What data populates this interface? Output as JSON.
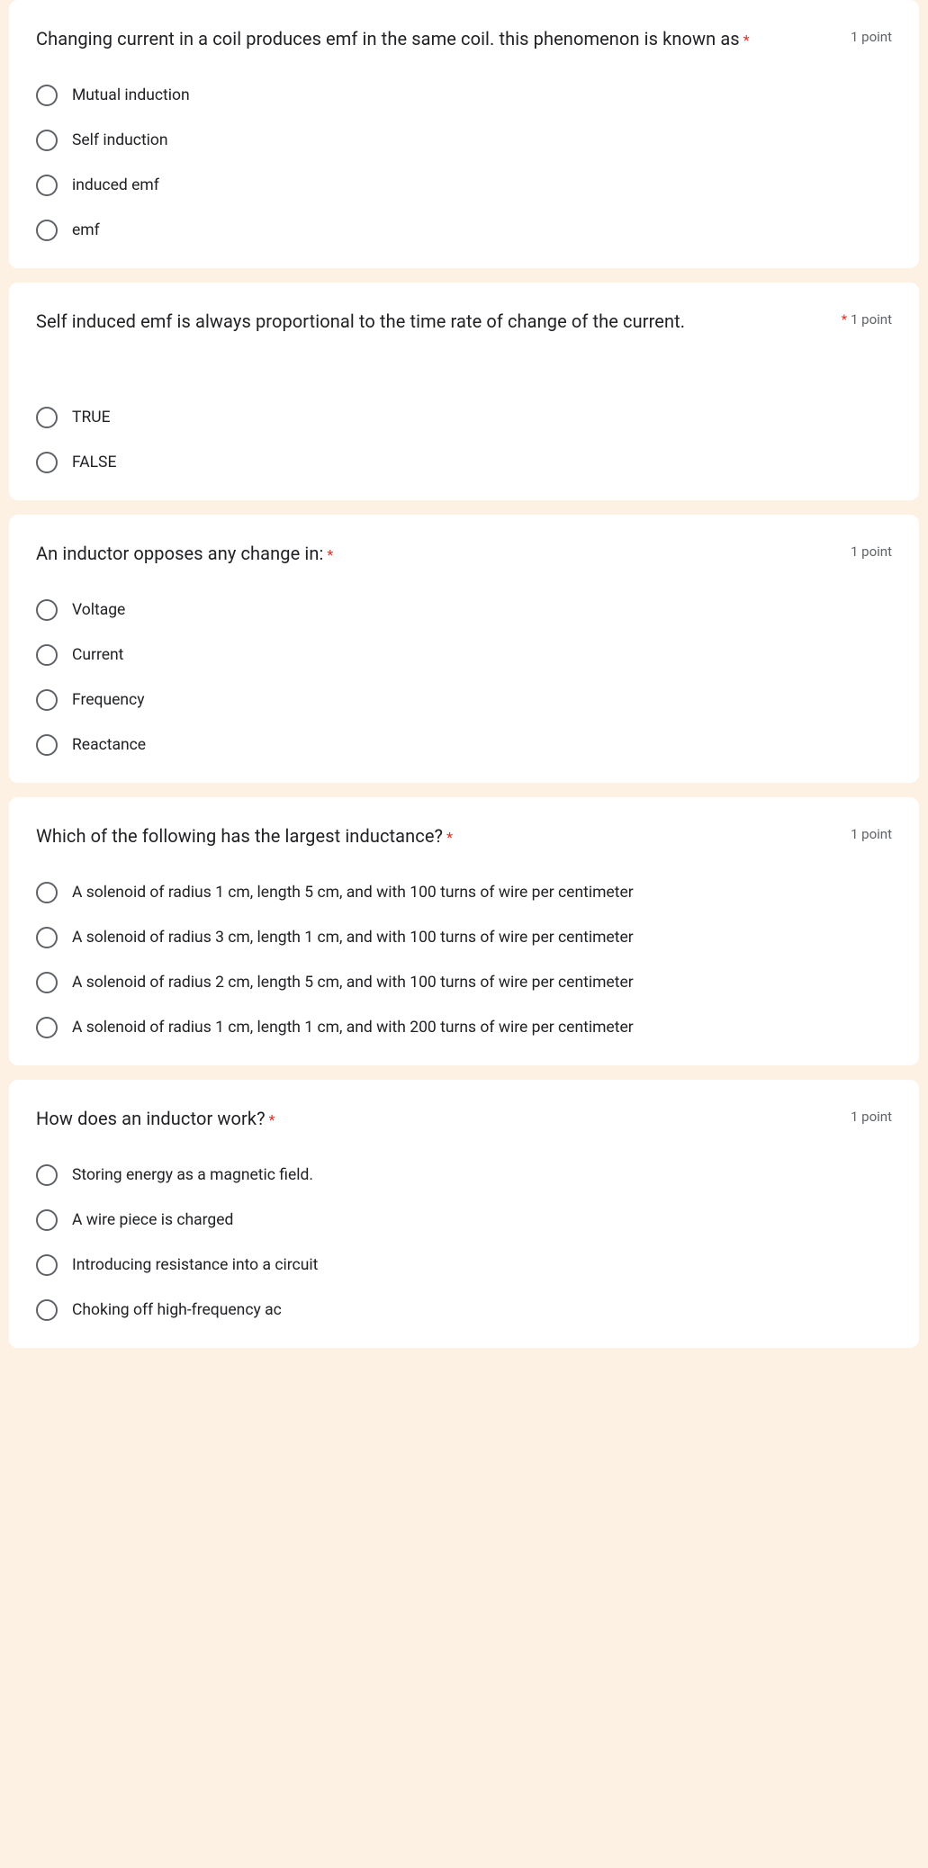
{
  "points_label": "1 point",
  "questions": [
    {
      "title": "Changing current in a coil produces emf in the same coil. this phenomenon is known as",
      "required_after_title": true,
      "extra_space": false,
      "options": [
        "Mutual induction",
        "Self induction",
        "induced emf",
        "emf"
      ]
    },
    {
      "title": "Self induced emf  is always proportional to the time rate of change of the current.",
      "required_after_title": false,
      "required_in_points": true,
      "extra_space": true,
      "options": [
        "TRUE",
        "FALSE"
      ]
    },
    {
      "title": "An inductor opposes any change in:",
      "required_after_title": true,
      "extra_space": false,
      "options": [
        "Voltage",
        "Current",
        "Frequency",
        "Reactance"
      ]
    },
    {
      "title": "Which of the following has the largest inductance?",
      "required_after_title": true,
      "extra_space": false,
      "options": [
        "A solenoid of radius 1 cm, length 5 cm, and with 100 turns of wire per centimeter",
        "A solenoid of radius 3 cm, length 1 cm, and with 100 turns of wire per centimeter",
        "A solenoid of radius 2 cm, length 5 cm, and with 100 turns of wire per centimeter",
        "A solenoid of radius 1 cm, length 1 cm, and with 200 turns of wire per centimeter"
      ]
    },
    {
      "title": "How does an inductor work?",
      "required_after_title": true,
      "extra_space": false,
      "options": [
        "Storing energy as a magnetic field.",
        "A wire piece is charged",
        "Introducing resistance into a circuit",
        "Choking off high-frequency ac"
      ]
    }
  ]
}
